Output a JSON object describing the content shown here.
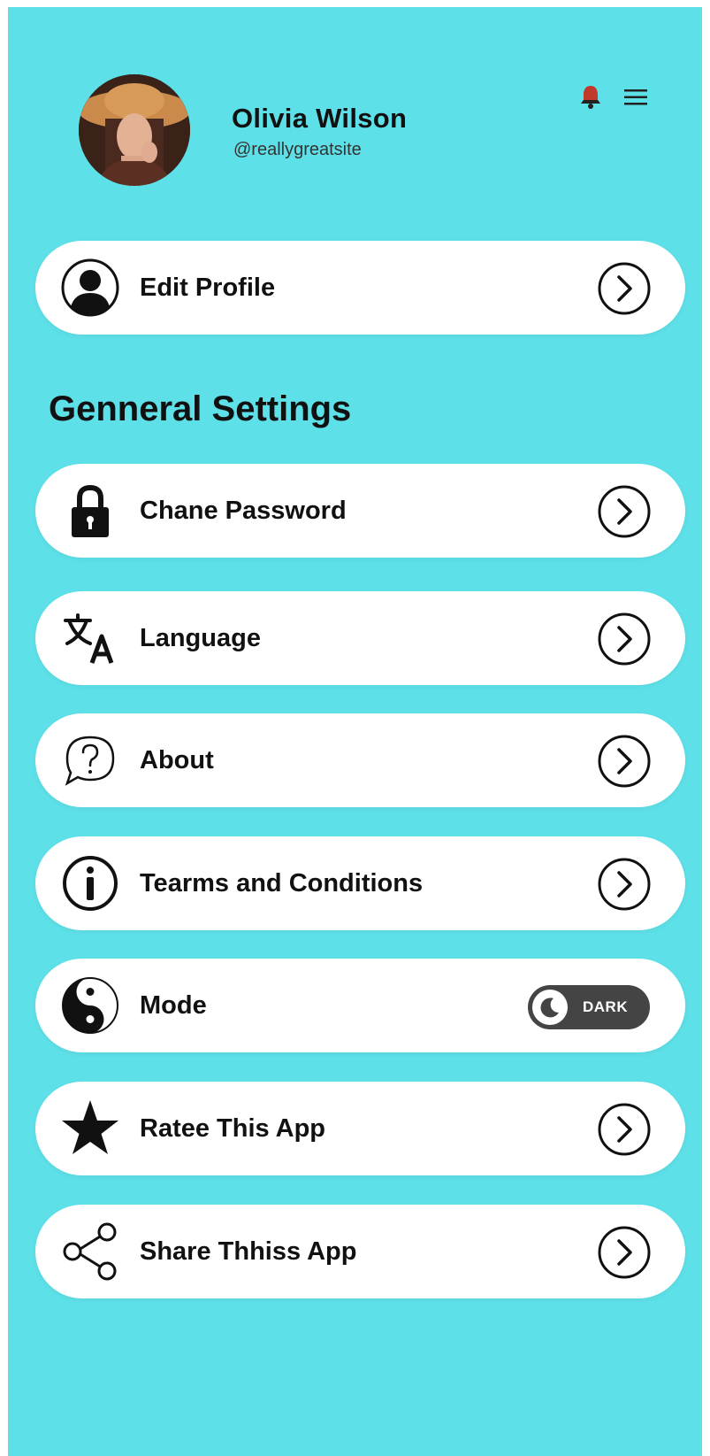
{
  "colors": {
    "background": "#5ee0e8",
    "card": "#ffffff",
    "text": "#111111",
    "bell": "#c0392b",
    "toggle_track": "#444444"
  },
  "profile": {
    "name": "Olivia Wilson",
    "handle": "@reallygreatsite"
  },
  "header_icons": [
    "bell-icon",
    "menu-icon"
  ],
  "edit_profile": {
    "label": "Edit Profile",
    "icon": "user-icon"
  },
  "section_title": "Genneral Settings",
  "settings": {
    "items": [
      {
        "label": "Chane Password",
        "icon": "lock-icon"
      },
      {
        "label": "Language",
        "icon": "translate-icon"
      },
      {
        "label": "About",
        "icon": "question-bubble-icon"
      },
      {
        "label": "Tearms and Conditions",
        "icon": "info-icon"
      },
      {
        "label": "Mode",
        "icon": "yin-yang-icon",
        "toggle": {
          "label": "DARK",
          "state": "dark"
        }
      },
      {
        "label": "Ratee This App",
        "icon": "star-icon"
      },
      {
        "label": "Share Thhiss App",
        "icon": "share-icon"
      }
    ]
  }
}
